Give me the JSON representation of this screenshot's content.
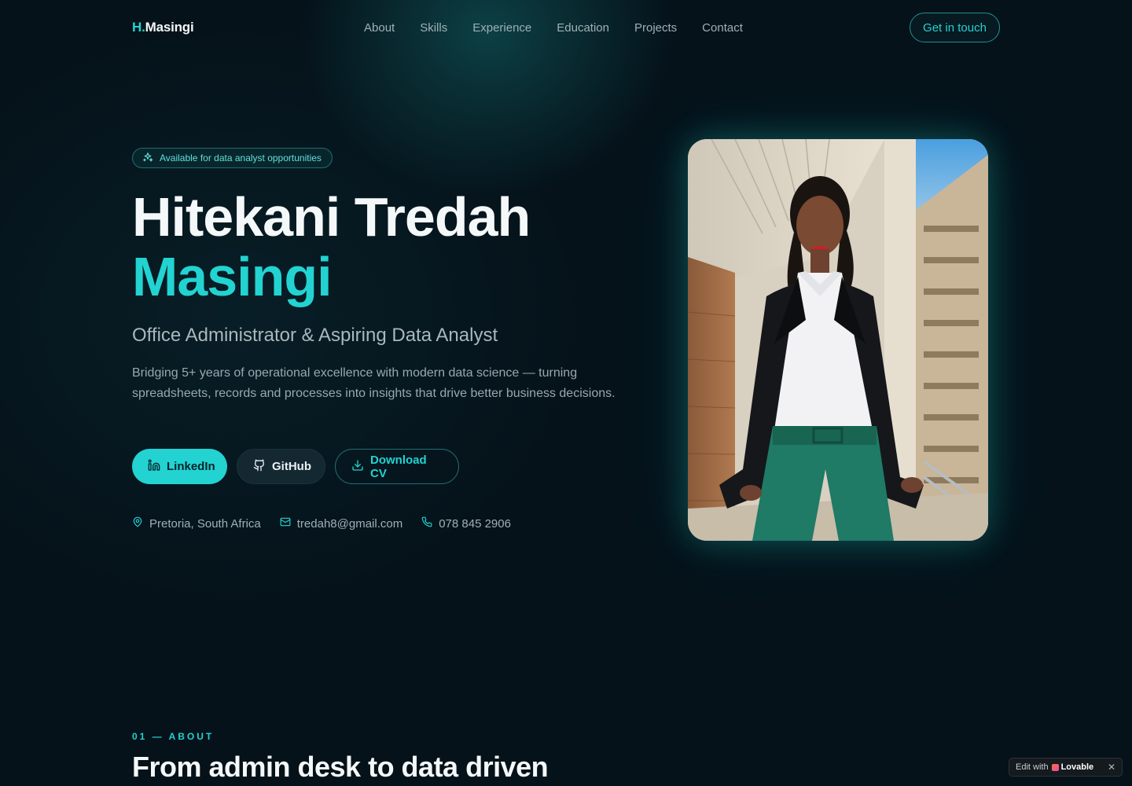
{
  "nav": {
    "logo_prefix": "H.",
    "logo_name": "Masingi",
    "links": [
      "About",
      "Skills",
      "Experience",
      "Education",
      "Projects",
      "Contact"
    ],
    "cta": "Get in touch"
  },
  "hero": {
    "badge": "Available for data analyst opportunities",
    "name_line1": "Hitekani Tredah",
    "name_line2": "Masingi",
    "subtitle": "Office Administrator & Aspiring Data Analyst",
    "description": "Bridging 5+ years of operational excellence with modern data science — turning spreadsheets, records and processes into insights that drive better business decisions.",
    "buttons": {
      "linkedin": "LinkedIn",
      "github": "GitHub",
      "cv": "Download CV"
    },
    "contact": {
      "location": "Pretoria, South Africa",
      "email": "tredah8@gmail.com",
      "phone": "078 845 2906"
    }
  },
  "about": {
    "kicker": "01 — ABOUT",
    "title": "From admin desk to data driven"
  },
  "lovable_badge": {
    "prefix": "Edit with",
    "brand": "Lovable",
    "close": "✕"
  },
  "colors": {
    "accent": "#22d3d1",
    "background": "#05121a"
  },
  "icons": [
    "sparkles-icon",
    "linkedin-icon",
    "github-icon",
    "download-icon",
    "map-pin-icon",
    "mail-icon",
    "phone-icon"
  ]
}
